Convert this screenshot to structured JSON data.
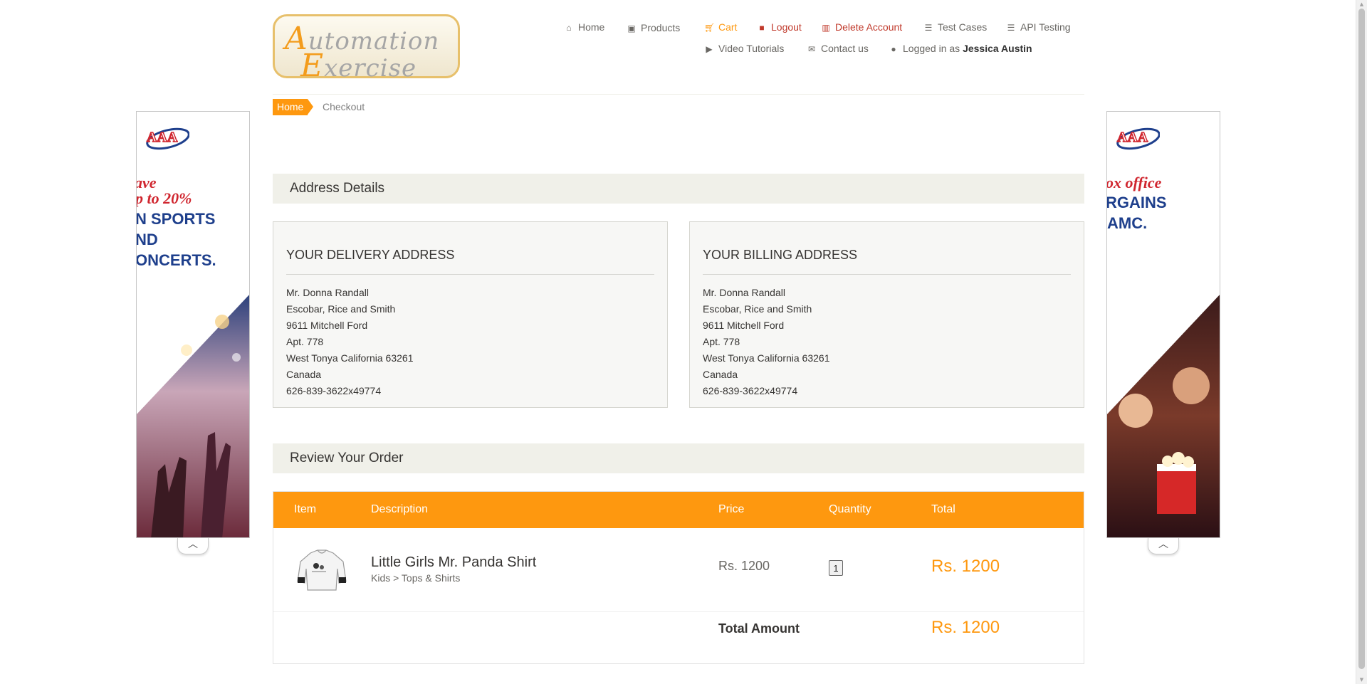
{
  "logo": {
    "line1_cap": "A",
    "line1_rest": "utomation",
    "line2_cap": "E",
    "line2_rest": "xercise"
  },
  "nav": {
    "home": "Home",
    "products": "Products",
    "cart": "Cart",
    "logout": "Logout",
    "delete_account": "Delete Account",
    "test_cases": "Test Cases",
    "api_testing": "API Testing",
    "video_tutorials": "Video Tutorials",
    "contact_us": "Contact us",
    "logged_in_prefix": "Logged in as",
    "logged_in_user": "Jessica Austin"
  },
  "breadcrumb": {
    "home": "Home",
    "current": "Checkout"
  },
  "address_section": {
    "title": "Address Details"
  },
  "delivery": {
    "title": "YOUR DELIVERY ADDRESS",
    "lines": [
      "Mr. Donna Randall",
      "Escobar, Rice and Smith",
      "9611 Mitchell Ford",
      "Apt. 778",
      "West Tonya California 63261",
      "Canada",
      "626-839-3622x49774"
    ]
  },
  "billing": {
    "title": "YOUR BILLING ADDRESS",
    "lines": [
      "Mr. Donna Randall",
      "Escobar, Rice and Smith",
      "9611 Mitchell Ford",
      "Apt. 778",
      "West Tonya California 63261",
      "Canada",
      "626-839-3622x49774"
    ]
  },
  "review_section": {
    "title": "Review Your Order"
  },
  "order_table": {
    "headers": {
      "item": "Item",
      "description": "Description",
      "price": "Price",
      "quantity": "Quantity",
      "total": "Total"
    },
    "rows": [
      {
        "name": "Little Girls Mr. Panda Shirt",
        "category": "Kids > Tops & Shirts",
        "price": "Rs. 1200",
        "quantity": "1",
        "total": "Rs. 1200"
      }
    ],
    "total_label": "Total Amount",
    "total_amount": "Rs. 1200"
  },
  "ads": {
    "left": {
      "brand": "AAA",
      "lines": [
        "ave",
        "p to 20%",
        "N SPORTS",
        "ND",
        "ONCERTS."
      ]
    },
    "right": {
      "brand": "AAA",
      "lines": [
        "ox office",
        "RGAINS",
        "AMC."
      ]
    }
  },
  "colors": {
    "accent": "#fe980f",
    "header_bg": "#f0f0e9",
    "danger": "#c0392b"
  }
}
